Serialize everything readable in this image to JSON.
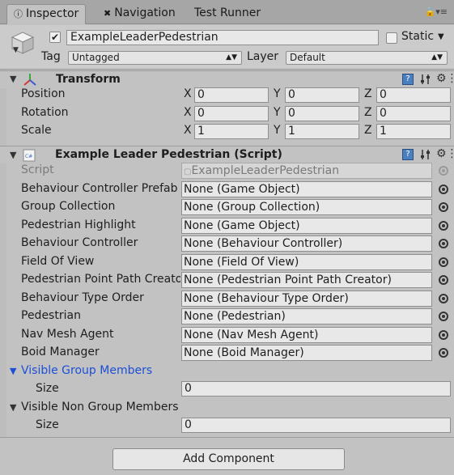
{
  "tabs": [
    {
      "label": "Inspector",
      "icon": "info-icon",
      "active": true
    },
    {
      "label": "Navigation",
      "icon": "navigation-icon",
      "active": false
    },
    {
      "label": "Test Runner",
      "active": false
    }
  ],
  "header": {
    "object_name": "ExampleLeaderPedestrian",
    "active": true,
    "static_label": "Static",
    "tag_label": "Tag",
    "tag_value": "Untagged",
    "layer_label": "Layer",
    "layer_value": "Default"
  },
  "transform": {
    "title": "Transform",
    "rows": [
      {
        "label": "Position",
        "x": "0",
        "y": "0",
        "z": "0"
      },
      {
        "label": "Rotation",
        "x": "0",
        "y": "0",
        "z": "0"
      },
      {
        "label": "Scale",
        "x": "1",
        "y": "1",
        "z": "1"
      }
    ]
  },
  "axes": {
    "x": "X",
    "y": "Y",
    "z": "Z"
  },
  "script_component": {
    "title": "Example Leader Pedestrian (Script)",
    "script_label": "Script",
    "script_value": "ExampleLeaderPedestrian",
    "fields": [
      {
        "label": "Behaviour Controller Prefab",
        "value": "None (Game Object)"
      },
      {
        "label": "Group Collection",
        "value": "None (Group Collection)"
      },
      {
        "label": "Pedestrian Highlight",
        "value": "None (Game Object)"
      },
      {
        "label": "Behaviour Controller",
        "value": "None (Behaviour Controller)"
      },
      {
        "label": "Field Of View",
        "value": "None (Field Of View)"
      },
      {
        "label": "Pedestrian Point Path Creator",
        "value": "None (Pedestrian Point Path Creator)"
      },
      {
        "label": "Behaviour Type Order",
        "value": "None (Behaviour Type Order)"
      },
      {
        "label": "Pedestrian",
        "value": "None (Pedestrian)"
      },
      {
        "label": "Nav Mesh Agent",
        "value": "None (Nav Mesh Agent)"
      },
      {
        "label": "Boid Manager",
        "value": "None (Boid Manager)"
      }
    ],
    "visible_group_members": {
      "label": "Visible Group Members",
      "size_label": "Size",
      "size": "0"
    },
    "visible_non_group_members": {
      "label": "Visible Non Group Members",
      "size_label": "Size",
      "size": "0"
    }
  },
  "add_component_label": "Add Component",
  "colors": {
    "selected_foldout": "#1c4fd6",
    "help_button": "#4a7fc0"
  }
}
